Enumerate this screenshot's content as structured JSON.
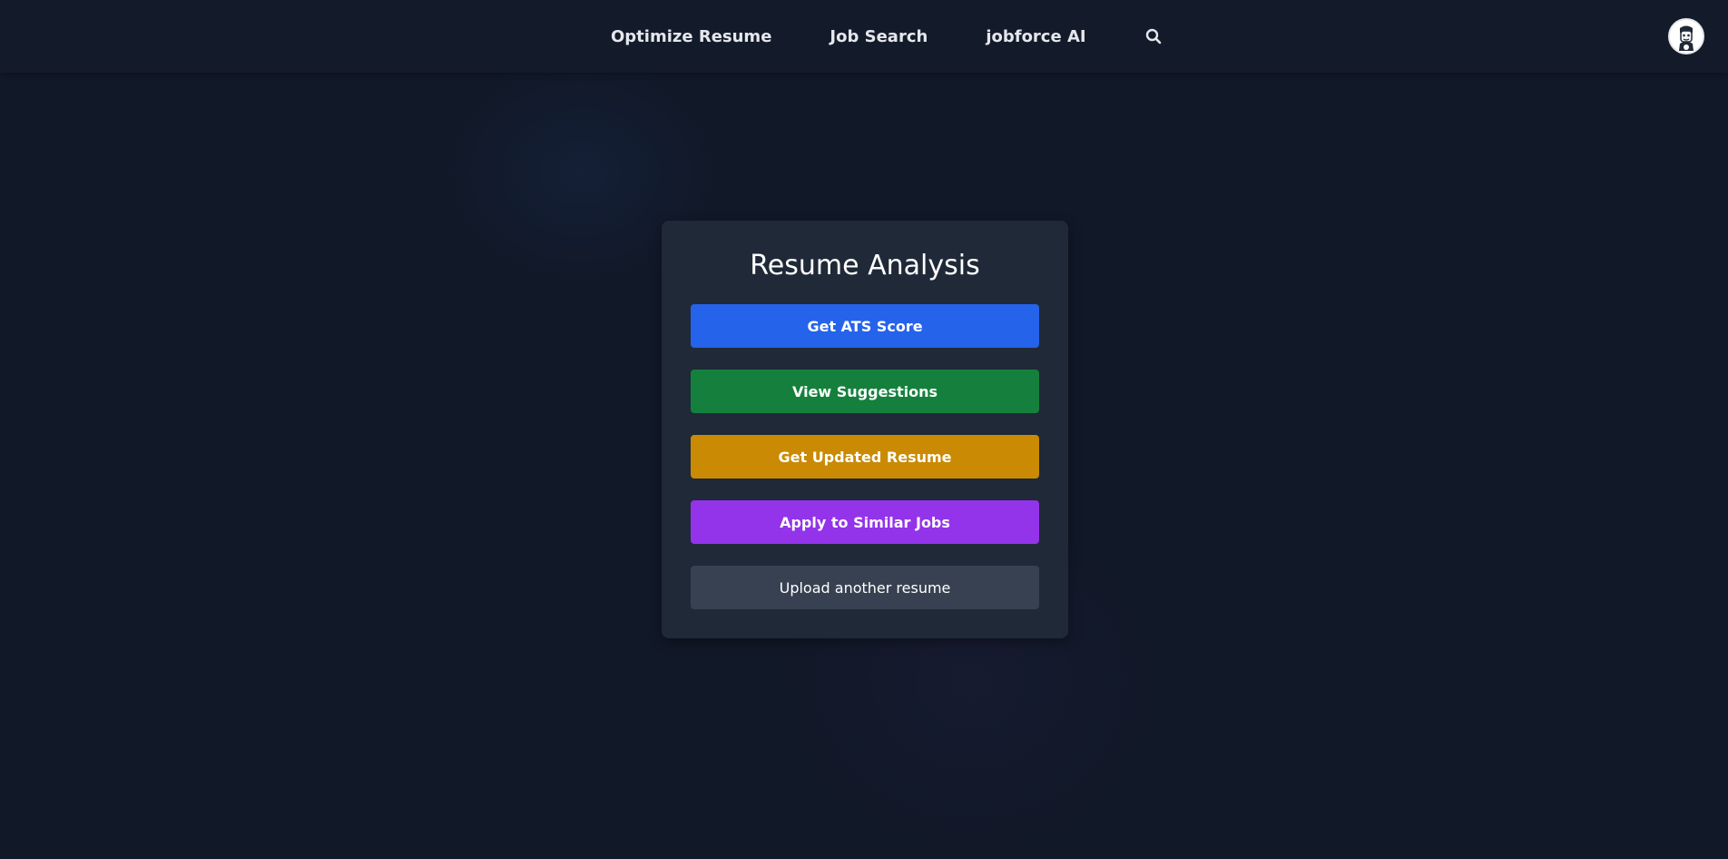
{
  "colors": {
    "background": "#111827",
    "navbar": "#131b2b",
    "card": "#1f2937",
    "ats_button": "#2563eb",
    "suggestions_button": "#15803d",
    "updated_resume_button": "#ca8a04",
    "apply_button": "#9333ea",
    "upload_button": "#374151"
  },
  "nav": {
    "links": [
      {
        "label": "Optimize Resume"
      },
      {
        "label": "Job Search"
      },
      {
        "label": "jobforce AI"
      }
    ],
    "search_icon": "search-icon",
    "avatar_icon": "user-avatar"
  },
  "card": {
    "title": "Resume Analysis",
    "buttons": {
      "ats": "Get ATS Score",
      "suggestions": "View Suggestions",
      "updated_resume": "Get Updated Resume",
      "apply": "Apply to Similar Jobs",
      "upload": "Upload another resume"
    }
  }
}
